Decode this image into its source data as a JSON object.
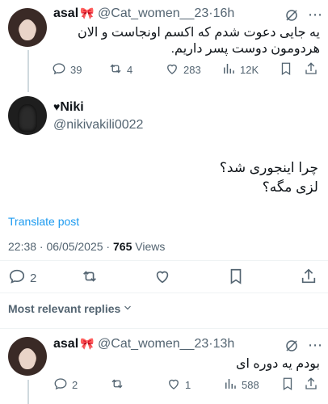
{
  "reply_to_tweet": {
    "author_name": "asal",
    "author_emoji": "🎀",
    "handle": "@Cat_women__23",
    "separator": "·",
    "time": "16h",
    "text": "یه جایی دعوت شدم که اکسم اونجاست و الان هردومون دوست پسر داریم.",
    "actions": {
      "replies": "39",
      "retweets": "4",
      "likes": "283",
      "views": "12K"
    }
  },
  "main_tweet": {
    "author_name": "Niki",
    "handle": "@nikivakili0022",
    "text_line1": "چرا اینجوری شد؟",
    "text_line2": "لزی مگه؟",
    "translate": "Translate post",
    "timestamp": "22:38 · 06/05/2025 · ",
    "views_count": "765",
    "views_label": " Views",
    "actions": {
      "replies": "2"
    }
  },
  "replies_header": {
    "label": "Most relevant replies"
  },
  "reply_tweet": {
    "author_name": "asal",
    "author_emoji": "🎀",
    "handle": "@Cat_women__23",
    "separator": "·",
    "time": "13h",
    "text": "بودم یه دوره ای",
    "actions": {
      "replies": "2",
      "retweets": "",
      "likes": "1",
      "views": "588"
    }
  },
  "colors": {
    "text": "#0f1419",
    "muted": "#536471",
    "link": "#1d9bf0",
    "divider": "#eff3f4"
  }
}
